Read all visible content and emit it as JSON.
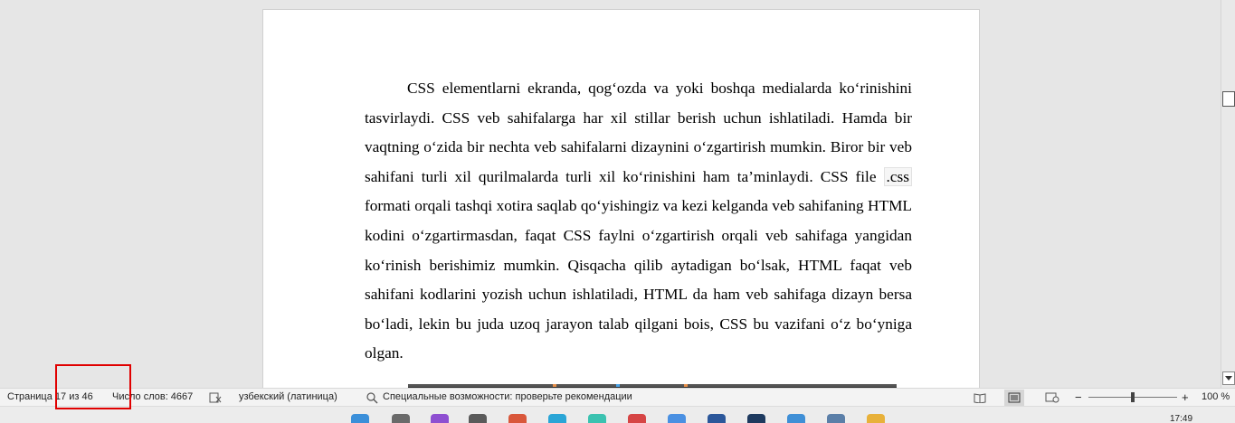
{
  "document": {
    "paragraph_parts": [
      "CSS elementlarni ekranda, qog‘ozda va yoki boshqa medialarda ko‘rinishini tasvirlaydi. CSS veb sahifalarga har xil stillar berish uchun ishlatiladi. Hamda bir vaqtning o‘zida bir nechta veb sahifalarni dizaynini o‘zgartirish mumkin. Biror bir veb sahifani turli xil qurilmalarda turli xil ko‘rinishini ham ta’minlaydi. CSS file ",
      ".css",
      " formati orqali tashqi xotira saqlab qo‘yishingiz va kezi kelganda veb sahifaning HTML kodini o‘zgartirmasdan, faqat CSS faylni o‘zgartirish orqali veb sahifaga yangidan ko‘rinish berishimiz mumkin. Qisqacha qilib aytadigan bo‘lsak, HTML faqat veb sahifani kodlarini yozish uchun ishlatiladi, HTML da ham veb sahifaga dizayn bersa bo‘ladi, lekin bu juda uzoq jarayon talab qilgani bois, CSS bu vazifani o‘z bo‘yniga olgan."
    ]
  },
  "statusbar": {
    "page_info": "Страница 17 из 46",
    "word_count": "Число слов: 4667",
    "proofing_icon": "spellcheck-icon",
    "language": "узбекский (латиница)",
    "accessibility_icon": "accessibility-icon",
    "accessibility": "Специальные возможности: проверьте рекомендации",
    "zoom_minus": "−",
    "zoom_plus": "+",
    "zoom_level": "100 %",
    "view_icons": [
      "read-mode-icon",
      "print-layout-icon",
      "web-layout-icon"
    ],
    "active_view": "print-layout-icon"
  },
  "taskbar": {
    "clock": "17:49"
  },
  "colors": {
    "highlight": "#e00000",
    "page": "#ffffff",
    "workspace": "#e6e6e6"
  }
}
